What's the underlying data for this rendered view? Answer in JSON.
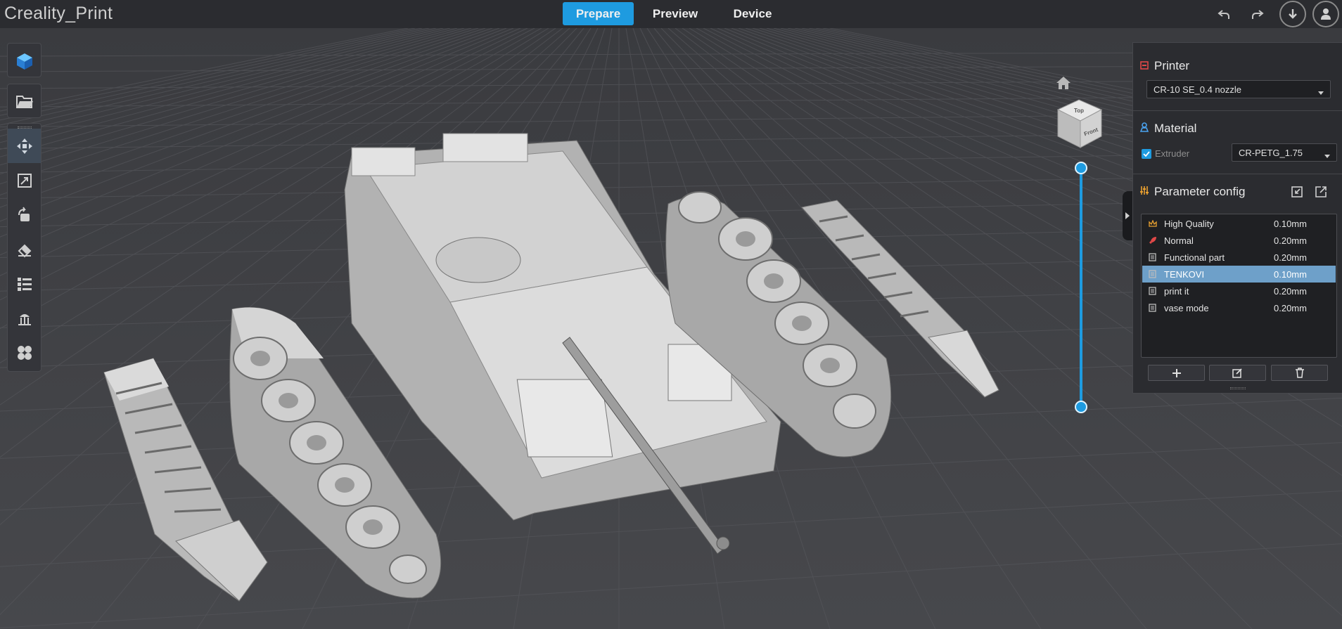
{
  "app": {
    "title": "Creality_Print"
  },
  "tabs": [
    {
      "label": "Prepare",
      "active": true
    },
    {
      "label": "Preview",
      "active": false
    },
    {
      "label": "Device",
      "active": false
    }
  ],
  "top_icons": [
    "undo-icon",
    "redo-icon",
    "download-icon",
    "user-icon"
  ],
  "left_toolbar": {
    "top_items": [
      "model-library-icon",
      "open-folder-icon"
    ],
    "tools": [
      "move-icon",
      "scale-icon",
      "rotate-icon",
      "lay-flat-icon",
      "list-icon",
      "support-icon",
      "arrange-icon"
    ],
    "active_tool": "move-icon"
  },
  "view_cube": {
    "top": "Top",
    "front": "Front"
  },
  "panel": {
    "printer": {
      "title": "Printer",
      "selected": "CR-10 SE_0.4 nozzle"
    },
    "material": {
      "title": "Material",
      "extruder_label": "Extruder",
      "extruder_checked": true,
      "selected": "CR-PETG_1.75"
    },
    "params": {
      "title": "Parameter config",
      "items": [
        {
          "name": "High Quality",
          "value": "0.10mm",
          "icon": "crown-icon",
          "selected": false
        },
        {
          "name": "Normal",
          "value": "0.20mm",
          "icon": "rocket-icon",
          "selected": false
        },
        {
          "name": "Functional part",
          "value": "0.20mm",
          "icon": "document-icon",
          "selected": false
        },
        {
          "name": "TENKOVI",
          "value": "0.10mm",
          "icon": "document-icon",
          "selected": true
        },
        {
          "name": "print it",
          "value": "0.20mm",
          "icon": "document-icon",
          "selected": false
        },
        {
          "name": "vase mode",
          "value": "0.20mm",
          "icon": "document-icon",
          "selected": false
        }
      ]
    }
  },
  "colors": {
    "accent": "#1e9be0",
    "selected_row": "#6ea0c9",
    "printer_icon": "#e04848",
    "material_icon": "#4aa3f0",
    "params_icon": "#e8a030"
  }
}
